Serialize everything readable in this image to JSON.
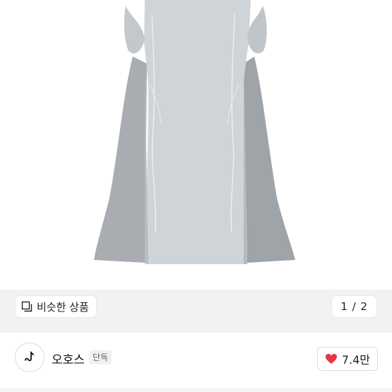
{
  "product": {
    "similar_button_label": "비슷한 상품",
    "pager": "1 / 2"
  },
  "seller": {
    "name": "오호스",
    "badge": "단독",
    "likes": "7.4만"
  },
  "icons": {
    "similar": "copy-icon",
    "like": "heart-icon",
    "avatar": "brand-logo-icon"
  },
  "colors": {
    "heart": "#e8353f",
    "image_background": "#f2f2f2"
  }
}
